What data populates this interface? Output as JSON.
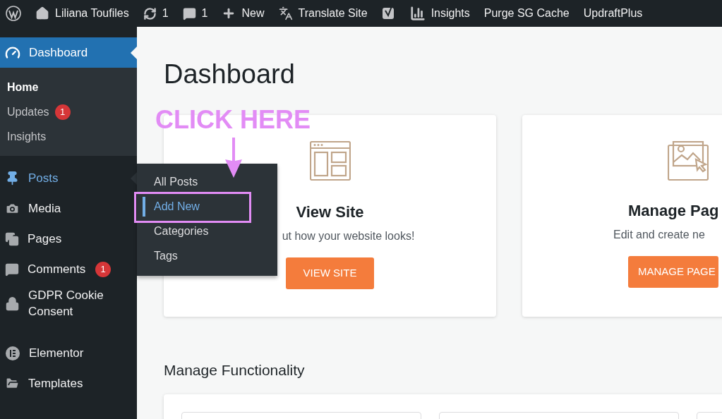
{
  "admin_bar": {
    "items": [
      {
        "kind": "logo"
      },
      {
        "kind": "site",
        "label": "Liliana Toufiles"
      },
      {
        "kind": "updates",
        "label": "1"
      },
      {
        "kind": "comments",
        "label": "1"
      },
      {
        "kind": "new",
        "label": "New"
      },
      {
        "kind": "translate",
        "label": "Translate Site"
      },
      {
        "kind": "yoast"
      },
      {
        "kind": "insights",
        "label": "Insights"
      },
      {
        "kind": "text",
        "label": "Purge SG Cache"
      },
      {
        "kind": "text",
        "label": "UpdraftPlus"
      }
    ]
  },
  "sidebar": {
    "items": [
      {
        "label": "Dashboard",
        "selected": true,
        "hovered": false,
        "children": [
          {
            "label": "Home",
            "selected": true
          },
          {
            "label": "Updates",
            "badge": "1",
            "selected": false
          },
          {
            "label": "Insights",
            "selected": false
          }
        ]
      },
      {
        "label": "Posts",
        "selected": false,
        "hovered": true
      },
      {
        "label": "Media",
        "selected": false,
        "hovered": false
      },
      {
        "label": "Pages",
        "selected": false,
        "hovered": false
      },
      {
        "label": "Comments",
        "badge": "1",
        "selected": false,
        "hovered": false
      },
      {
        "label": "GDPR Cookie Consent",
        "selected": false,
        "hovered": false
      },
      {
        "label": "Elementor",
        "selected": false,
        "hovered": false
      },
      {
        "label": "Templates",
        "selected": false,
        "hovered": false
      }
    ]
  },
  "flyout": {
    "items": [
      {
        "label": "All Posts",
        "selected": false
      },
      {
        "label": "Add New",
        "selected": true
      },
      {
        "label": "Categories",
        "selected": false
      },
      {
        "label": "Tags",
        "selected": false
      }
    ]
  },
  "annotation": {
    "label": "CLICK HERE"
  },
  "page": {
    "title": "Dashboard",
    "cards": [
      {
        "title": "View Site",
        "text": "ut how your website looks!",
        "button": "VIEW SITE"
      },
      {
        "title": "Manage Pag",
        "text": "Edit and create ne",
        "button": "MANAGE PAGE"
      }
    ],
    "section_title": "Manage Functionality"
  }
}
